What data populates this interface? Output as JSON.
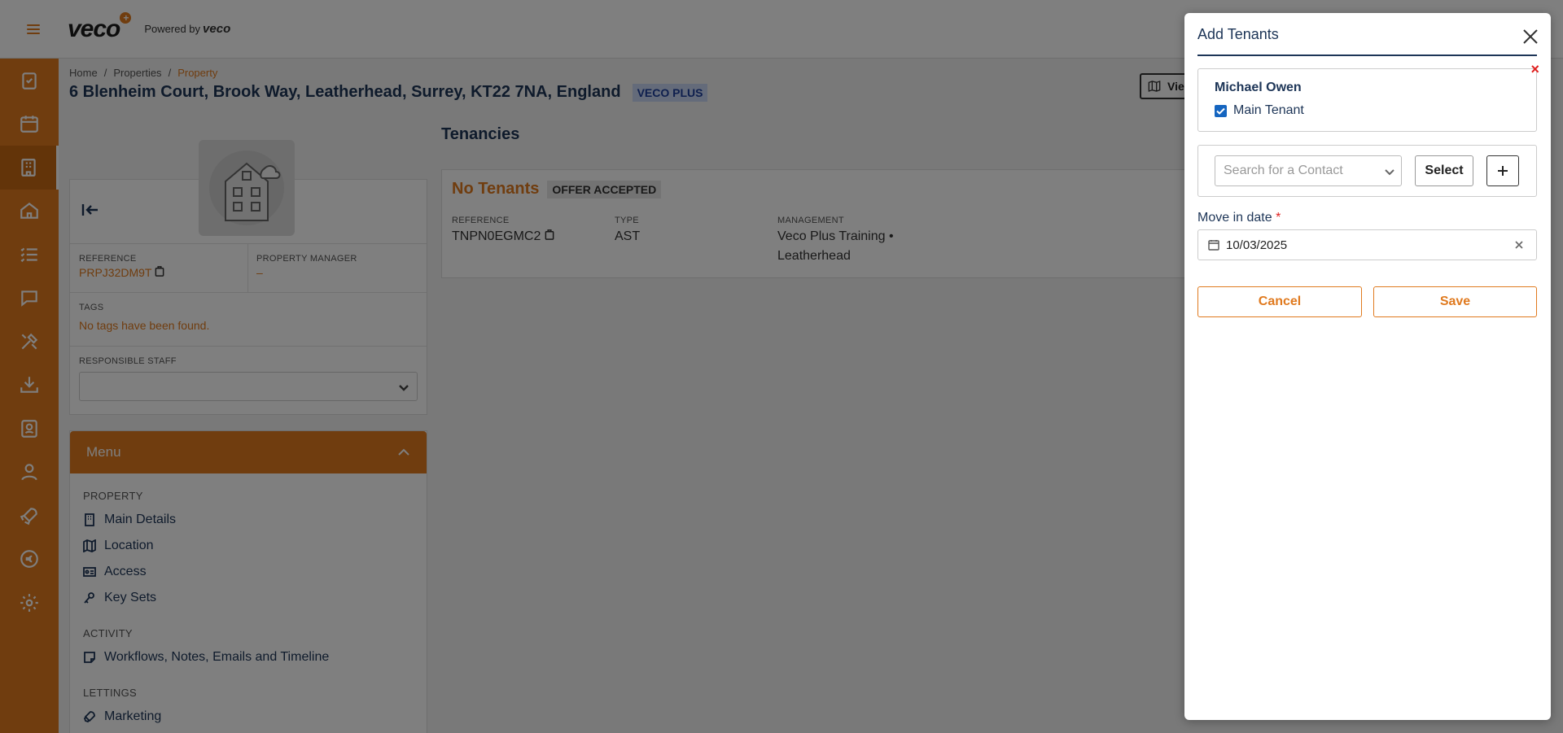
{
  "topbar": {
    "logo": "veco",
    "logo_plus": "+",
    "powered_by": "Powered by",
    "powered_brand": "veco"
  },
  "sidebar": {
    "items": [
      "tasks-icon",
      "calendar-icon",
      "building-icon",
      "home-icon",
      "list-icon",
      "chat-icon",
      "tools-icon",
      "inbox-icon",
      "contacts-icon",
      "person-icon",
      "rocket-icon",
      "currency-icon",
      "settings-icon"
    ],
    "active_index": 2
  },
  "breadcrumb": {
    "home": "Home",
    "sep": "/",
    "properties": "Properties",
    "current": "Property"
  },
  "page": {
    "title": "6 Blenheim Court, Brook Way, Leatherhead, Surrey, KT22 7NA, England",
    "badge": "VECO PLUS",
    "view_label": "Vie"
  },
  "property": {
    "reference_label": "REFERENCE",
    "reference": "PRPJ32DM9T",
    "manager_label": "PROPERTY MANAGER",
    "manager": "–",
    "tags_label": "TAGS",
    "tags": "No tags have been found.",
    "staff_label": "RESPONSIBLE STAFF"
  },
  "menu": {
    "title": "Menu",
    "sections": [
      {
        "title": "PROPERTY",
        "items": [
          {
            "label": "Main Details"
          },
          {
            "label": "Location"
          },
          {
            "label": "Access"
          },
          {
            "label": "Key Sets"
          }
        ]
      },
      {
        "title": "ACTIVITY",
        "items": [
          {
            "label": "Workflows, Notes, Emails and Timeline"
          }
        ]
      },
      {
        "title": "LETTINGS",
        "items": [
          {
            "label": "Marketing"
          }
        ]
      }
    ]
  },
  "tenancies": {
    "title": "Tenancies",
    "status": "No Tenants",
    "badge": "OFFER ACCEPTED",
    "reference_label": "REFERENCE",
    "reference": "TNPN0EGMC2",
    "type_label": "TYPE",
    "type": "AST",
    "management_label": "MANAGEMENT",
    "management_line1": "Veco Plus Training •",
    "management_line2": "Leatherhead"
  },
  "dialog": {
    "title": "Add Tenants",
    "tenant": {
      "name": "Michael Owen",
      "main_label": "Main Tenant",
      "main_checked": true,
      "remove": "×"
    },
    "search_placeholder": "Search for a Contact",
    "select_label": "Select",
    "move_in_label": "Move in date",
    "required_mark": "*",
    "move_in_date": "10/03/2025",
    "cancel_label": "Cancel",
    "save_label": "Save"
  },
  "colors": {
    "accent": "#e07a1f",
    "navy": "#1d3557",
    "danger": "#e0201f",
    "check": "#1565c0"
  }
}
